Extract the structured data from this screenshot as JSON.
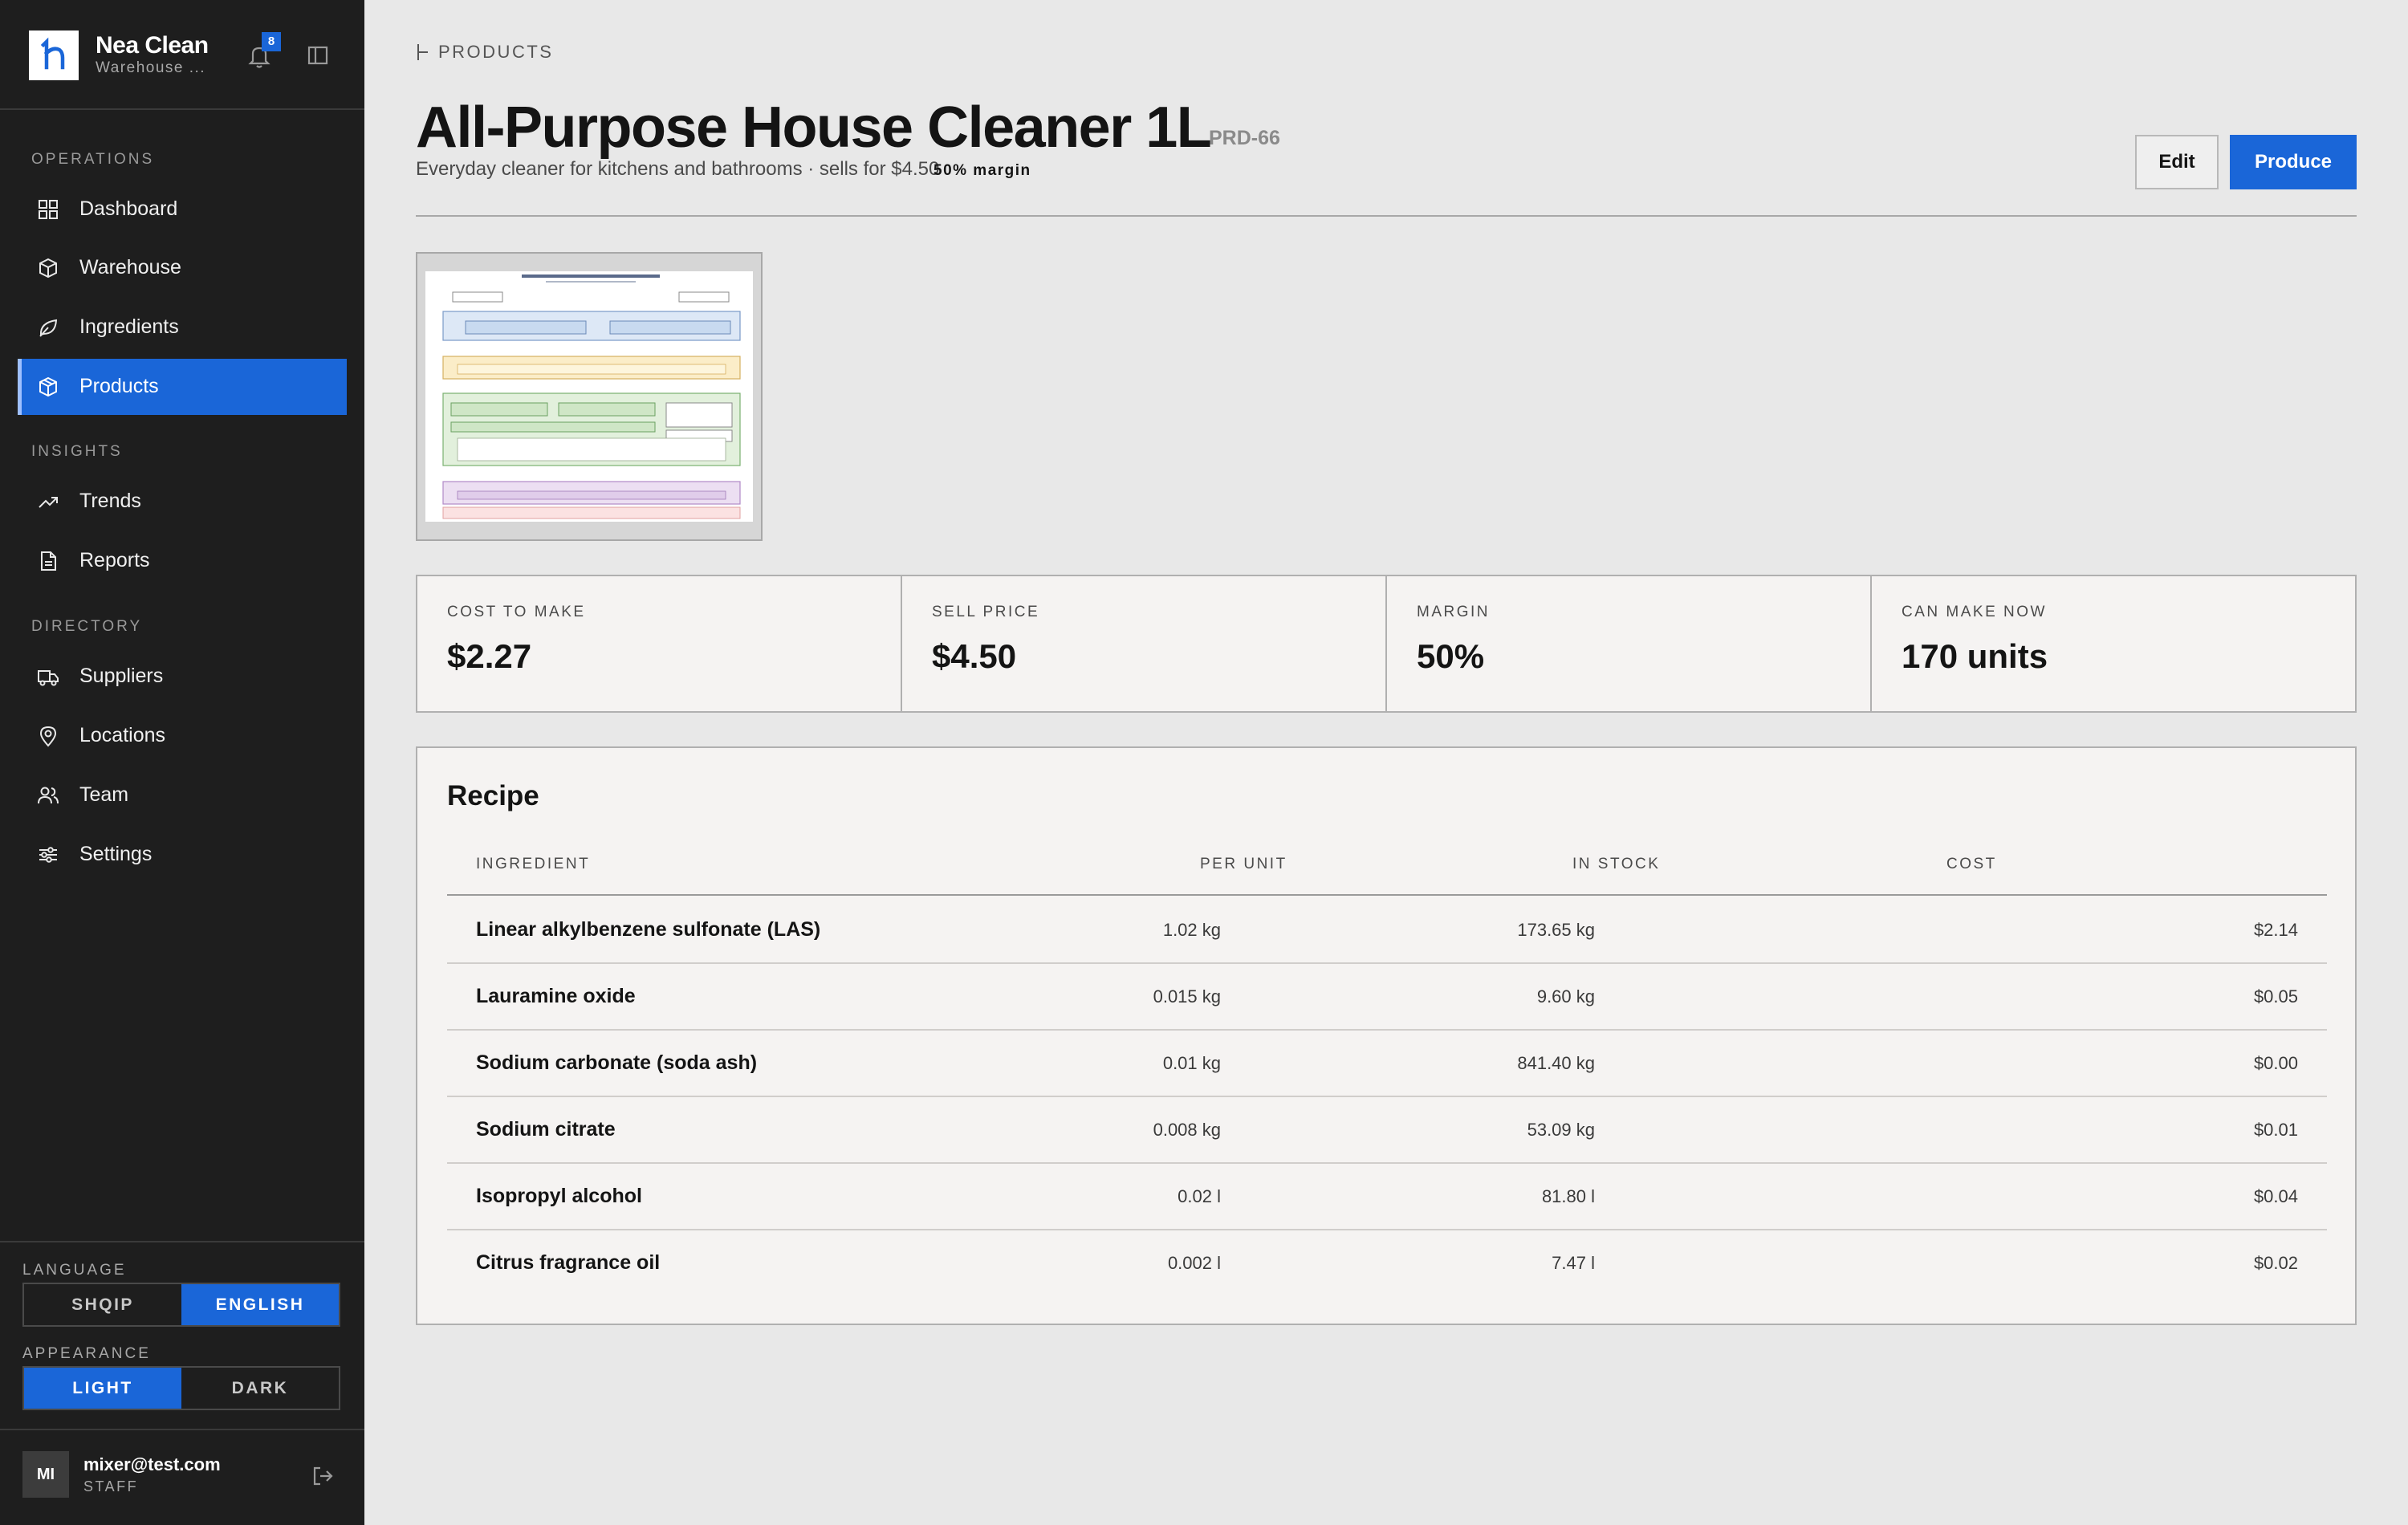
{
  "app": {
    "name": "Nea Clean",
    "subtitle": "Warehouse ...",
    "notifications": "8"
  },
  "sidebar": {
    "sections": {
      "operations": "OPERATIONS",
      "insights": "INSIGHTS",
      "directory": "DIRECTORY"
    },
    "items": {
      "dashboard": "Dashboard",
      "warehouse": "Warehouse",
      "ingredients": "Ingredients",
      "products": "Products",
      "trends": "Trends",
      "reports": "Reports",
      "suppliers": "Suppliers",
      "locations": "Locations",
      "team": "Team",
      "settings": "Settings"
    },
    "language": {
      "label": "LANGUAGE",
      "options": [
        "SHQIP",
        "ENGLISH"
      ],
      "selected": "ENGLISH"
    },
    "appearance": {
      "label": "APPEARANCE",
      "options": [
        "LIGHT",
        "DARK"
      ],
      "selected": "LIGHT"
    },
    "user": {
      "initials": "MI",
      "email": "mixer@test.com",
      "role": "STAFF"
    }
  },
  "breadcrumb": "PRODUCTS",
  "product": {
    "name": "All-Purpose House Cleaner 1L",
    "sku": "PRD-66",
    "description": "Everyday cleaner for kitchens and bathrooms · sells for $4.50",
    "margin_badge": "50% margin"
  },
  "actions": {
    "edit": "Edit",
    "produce": "Produce"
  },
  "stats": [
    {
      "label": "COST TO MAKE",
      "value": "$2.27"
    },
    {
      "label": "SELL PRICE",
      "value": "$4.50"
    },
    {
      "label": "MARGIN",
      "value": "50%"
    },
    {
      "label": "CAN MAKE NOW",
      "value": "170 units"
    }
  ],
  "recipe": {
    "title": "Recipe",
    "columns": [
      "INGREDIENT",
      "PER UNIT",
      "IN STOCK",
      "COST"
    ],
    "rows": [
      {
        "ingredient": "Linear alkylbenzene sulfonate (LAS)",
        "per_unit": "1.02 kg",
        "in_stock": "173.65 kg",
        "cost": "$2.14"
      },
      {
        "ingredient": "Lauramine oxide",
        "per_unit": "0.015 kg",
        "in_stock": "9.60 kg",
        "cost": "$0.05"
      },
      {
        "ingredient": "Sodium carbonate (soda ash)",
        "per_unit": "0.01 kg",
        "in_stock": "841.40 kg",
        "cost": "$0.00"
      },
      {
        "ingredient": "Sodium citrate",
        "per_unit": "0.008 kg",
        "in_stock": "53.09 kg",
        "cost": "$0.01"
      },
      {
        "ingredient": "Isopropyl alcohol",
        "per_unit": "0.02 l",
        "in_stock": "81.80 l",
        "cost": "$0.04"
      },
      {
        "ingredient": "Citrus fragrance oil",
        "per_unit": "0.002 l",
        "in_stock": "7.47 l",
        "cost": "$0.02"
      }
    ]
  },
  "colors": {
    "accent": "#1a66d8",
    "sidebar_bg": "#1e1e1e",
    "page_bg": "#e8e8e8",
    "card_bg": "#f5f3f2"
  }
}
